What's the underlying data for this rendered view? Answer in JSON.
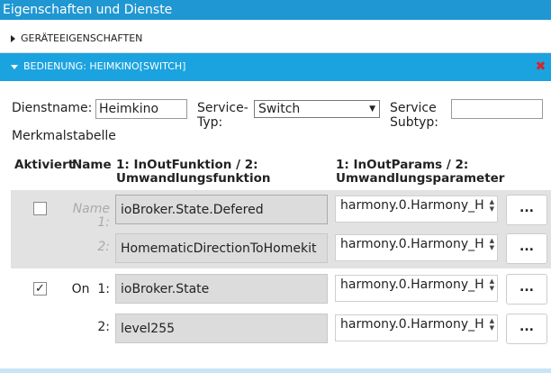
{
  "window": {
    "title": "Eigenschaften und Dienste"
  },
  "panels": [
    {
      "label": "GERÄTEEIGENSCHAFTEN",
      "expanded": false
    },
    {
      "label": "BEDIENUNG: HEIMKINO[SWITCH]",
      "expanded": true
    }
  ],
  "colors": {
    "titlebar": "#1f97d2",
    "active_panel": "#1ba3e0",
    "close": "#d9242a"
  },
  "form": {
    "dienstname_label": "Dienstname:",
    "dienstname_value": "Heimkino",
    "service_typ_label_1": "Service-",
    "service_typ_label_2": "Typ:",
    "service_typ_value": "Switch",
    "service_subtyp_label_1": "Service",
    "service_subtyp_label_2": "Subtyp:",
    "service_subtyp_value": ""
  },
  "table": {
    "title": "Merkmalstabelle",
    "headers": {
      "aktiviert": "Aktiviert",
      "name": "Name",
      "fn_1": "1: InOutFunktion / 2:",
      "fn_2": "Umwandlungsfunktion",
      "params_1": "1: InOutParams / 2:",
      "params_2": "Umwandlungsparameter"
    },
    "rows": [
      {
        "checked": false,
        "name_1": "Name",
        "name_2": "1:",
        "fn1": "ioBroker.State.Defered",
        "fn2": "HomematicDirectionToHomekit",
        "param1": "harmony.0.Harmony_H",
        "param2": "harmony.0.Harmony_H",
        "label2": "2:",
        "button": "..."
      },
      {
        "checked": true,
        "check_glyph": "✓",
        "name_1": "On",
        "name_2": "1:",
        "fn1": "ioBroker.State",
        "fn2": "level255",
        "param1": "harmony.0.Harmony_H",
        "param2": "harmony.0.Harmony_H",
        "label2": "2:",
        "button": "..."
      }
    ]
  }
}
